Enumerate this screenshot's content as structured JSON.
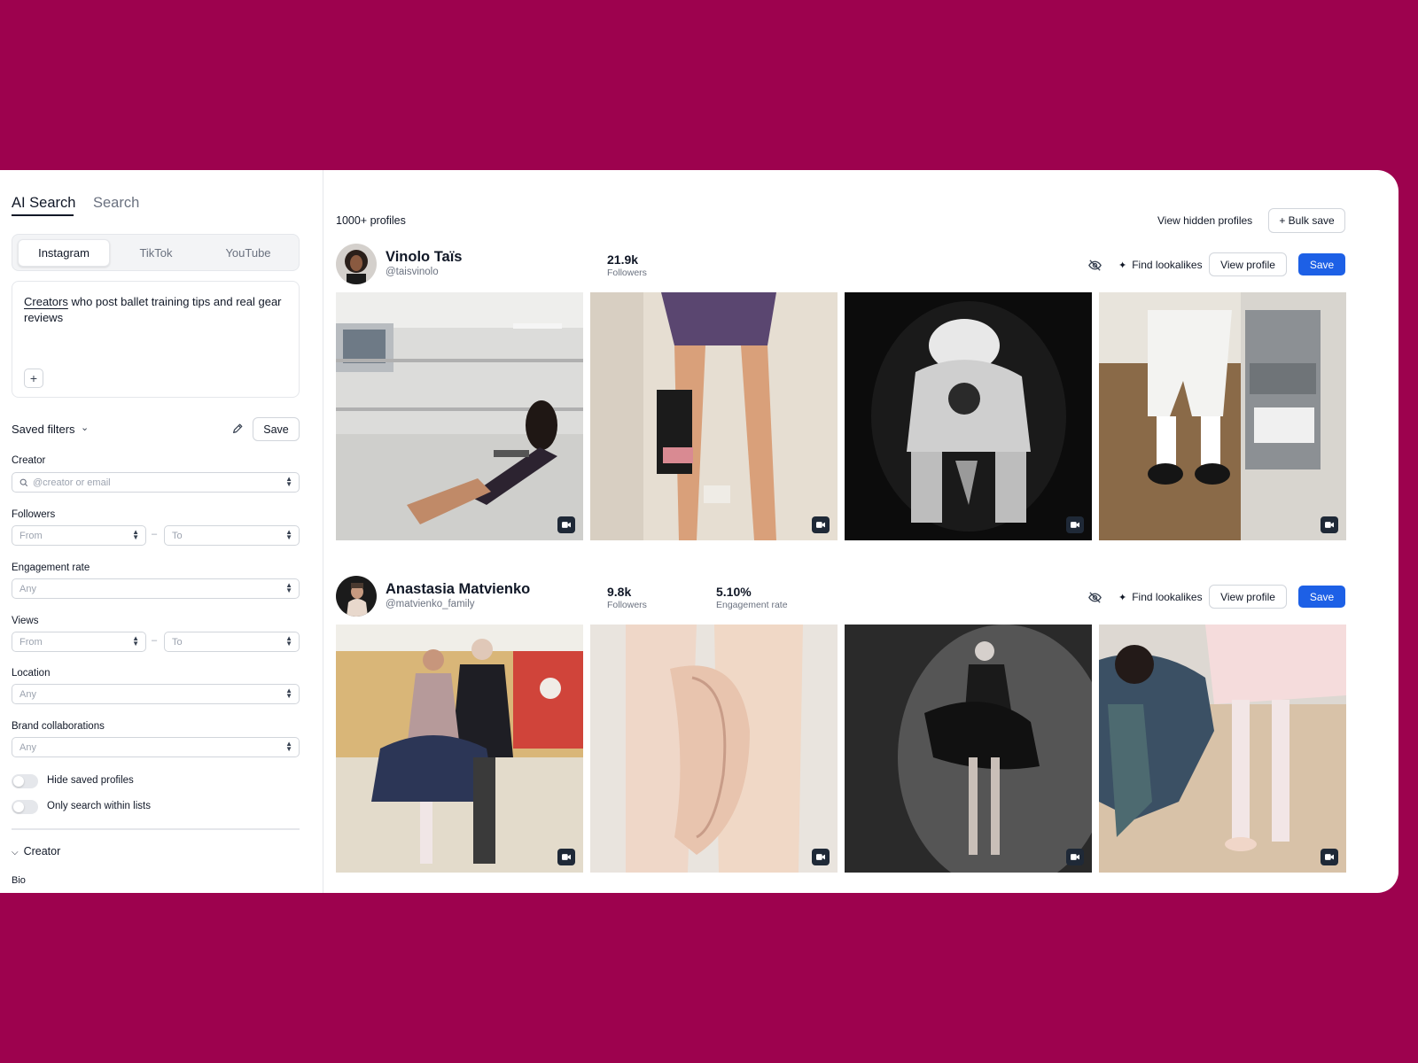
{
  "sidebar": {
    "mode_tabs": {
      "ai": "AI Search",
      "search": "Search"
    },
    "platforms": [
      "Instagram",
      "TikTok",
      "YouTube"
    ],
    "prompt": {
      "highlight": "Creators",
      "rest": " who post ballet training tips and real gear reviews"
    },
    "saved_filters": {
      "label": "Saved filters",
      "save": "Save"
    },
    "filters": {
      "creator": {
        "label": "Creator",
        "placeholder": "@creator or email"
      },
      "followers": {
        "label": "Followers",
        "from": "From",
        "to": "To"
      },
      "engagement": {
        "label": "Engagement rate",
        "value": "Any"
      },
      "views": {
        "label": "Views",
        "from": "From",
        "to": "To"
      },
      "location": {
        "label": "Location",
        "value": "Any"
      },
      "brand": {
        "label": "Brand collaborations",
        "value": "Any"
      }
    },
    "toggles": {
      "hide_saved": "Hide saved profiles",
      "only_lists": "Only search within lists"
    },
    "section": {
      "creator": "Creator",
      "bio": "Bio"
    }
  },
  "main": {
    "count": "1000+ profiles",
    "view_hidden": "View hidden profiles",
    "bulk_save": "+ Bulk save",
    "actions": {
      "lookalikes": "Find lookalikes",
      "view_profile": "View profile",
      "save": "Save"
    },
    "profiles": [
      {
        "name": "Vinolo Taïs",
        "handle": "@taisvinolo",
        "followers": "21.9k",
        "followers_label": "Followers"
      },
      {
        "name": "Anastasia Matvienko",
        "handle": "@matvienko_family",
        "followers": "9.8k",
        "followers_label": "Followers",
        "engagement": "5.10%",
        "engagement_label": "Engagement rate"
      }
    ]
  },
  "colors": {
    "background": "#9d024e",
    "primary": "#1d60e6"
  },
  "icons": [
    "search-icon",
    "pencil-icon",
    "chevron-down-icon",
    "eye-off-icon",
    "sparkle-icon",
    "video-icon",
    "plus-icon"
  ]
}
